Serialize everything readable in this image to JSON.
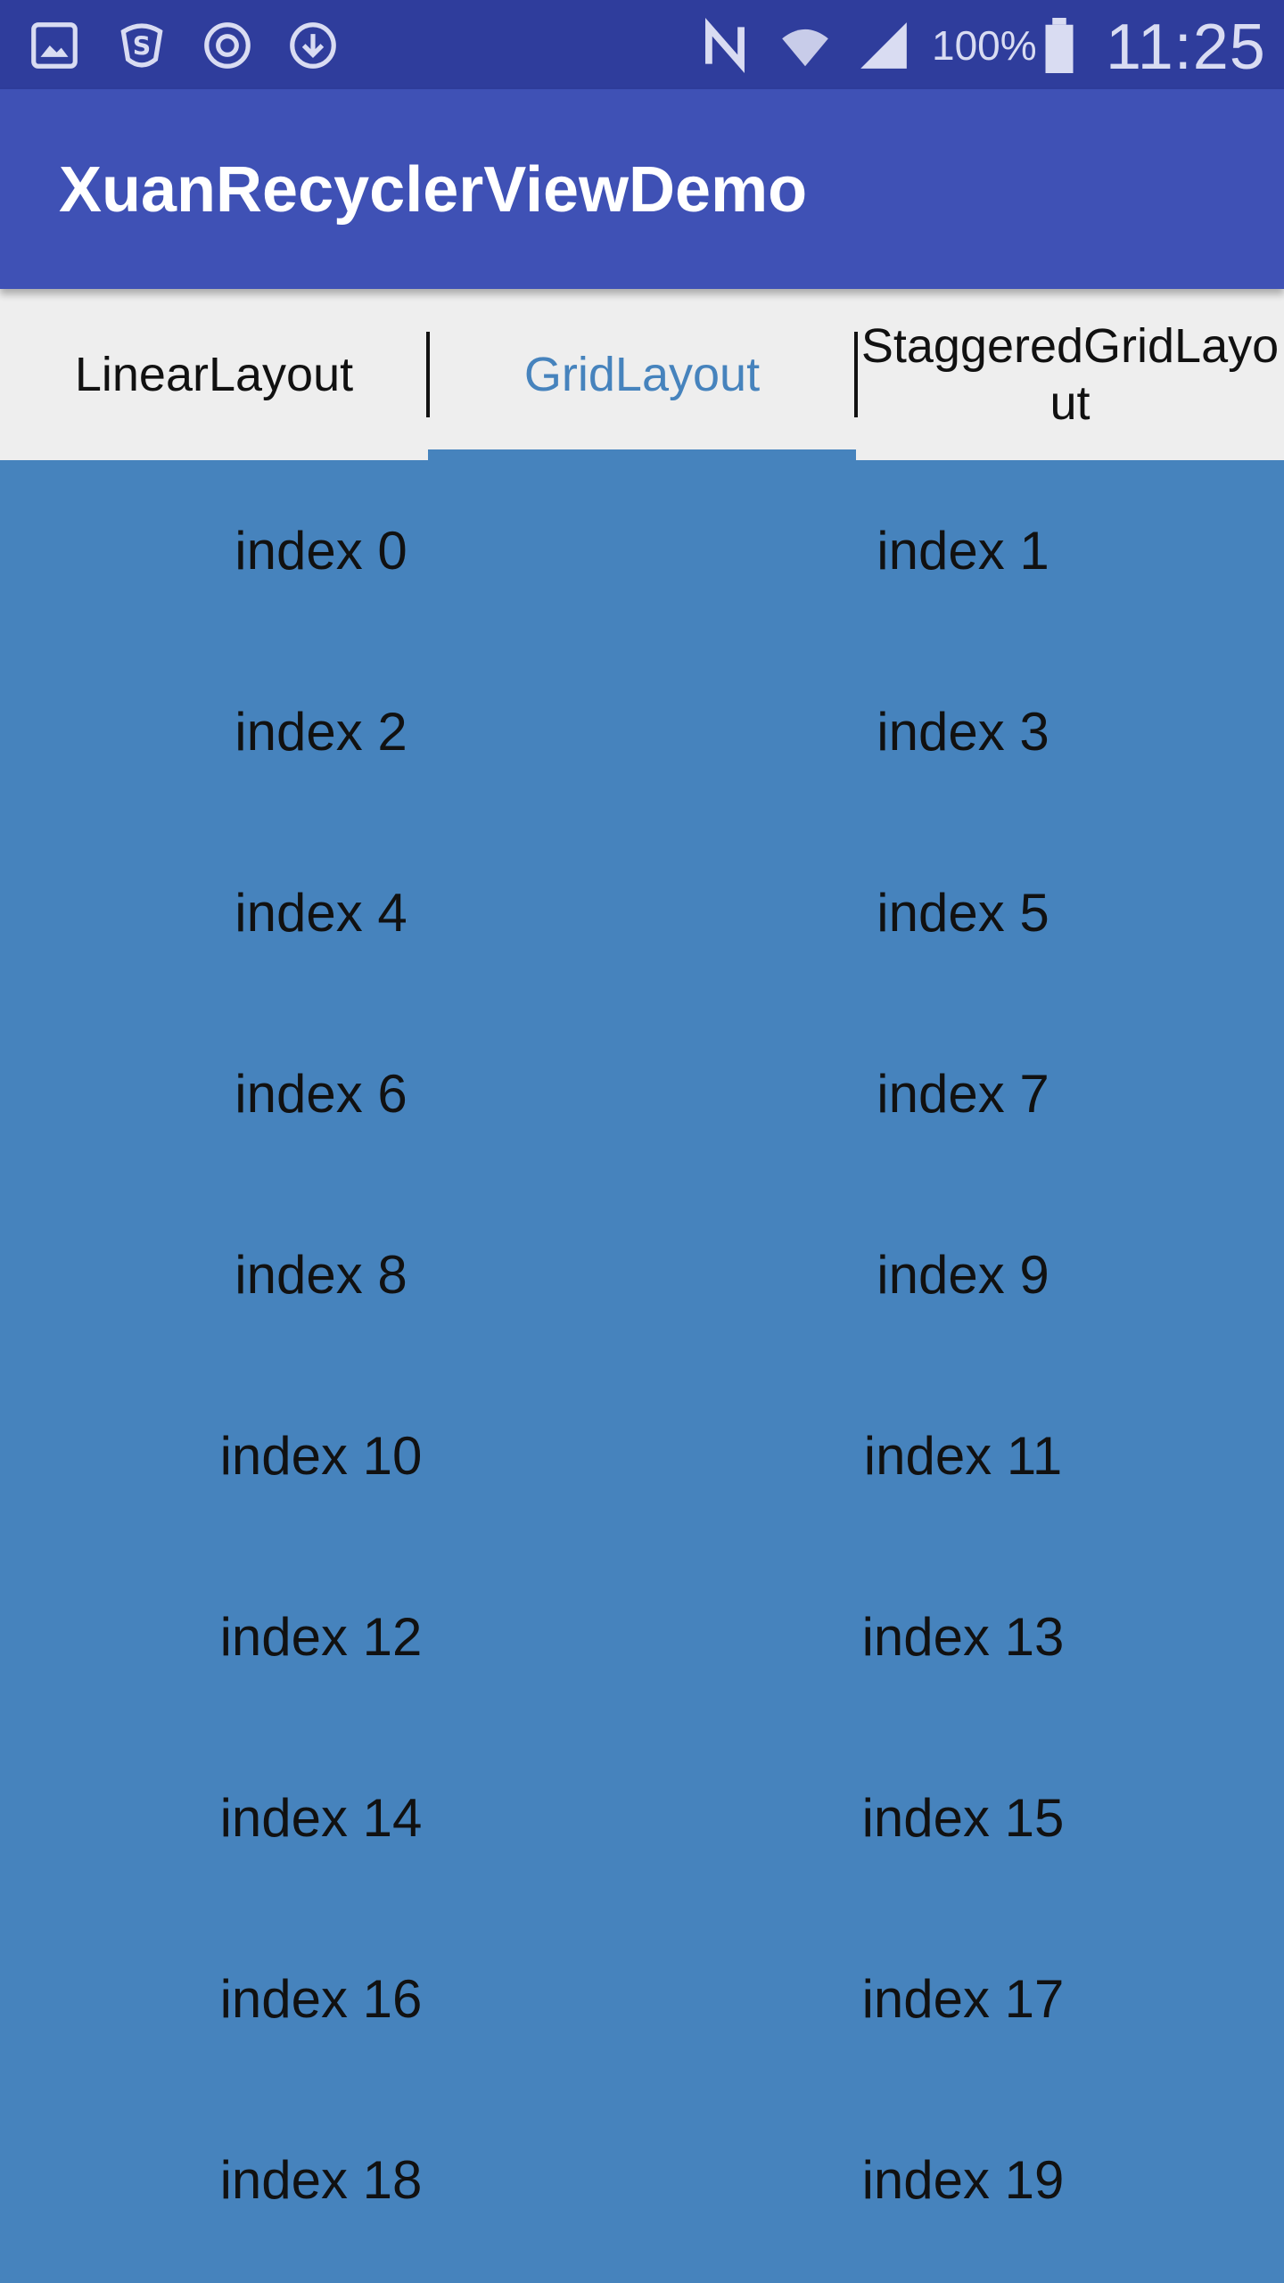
{
  "status_bar": {
    "icons": [
      "gallery-icon",
      "s-app-icon",
      "sync-icon",
      "download-icon",
      "nfc-icon",
      "wifi-icon",
      "signal-icon",
      "battery-icon"
    ],
    "battery": "100%",
    "time": "11:25"
  },
  "app_bar": {
    "title": "XuanRecyclerViewDemo",
    "color": "#3f51b5"
  },
  "tabs": [
    {
      "label": "LinearLayout",
      "active": false
    },
    {
      "label": "GridLayout",
      "active": true
    },
    {
      "label": "StaggeredGridLayout",
      "active": false
    }
  ],
  "colors": {
    "accent": "#4683bd",
    "status_bar": "#2f3d9c",
    "tab_background": "#eeeeee"
  },
  "grid": {
    "items": [
      "index 0",
      "index 1",
      "index 2",
      "index 3",
      "index 4",
      "index 5",
      "index 6",
      "index 7",
      "index 8",
      "index 9",
      "index 10",
      "index 11",
      "index 12",
      "index 13",
      "index 14",
      "index 15",
      "index 16",
      "index 17",
      "index 18",
      "index 19"
    ]
  }
}
